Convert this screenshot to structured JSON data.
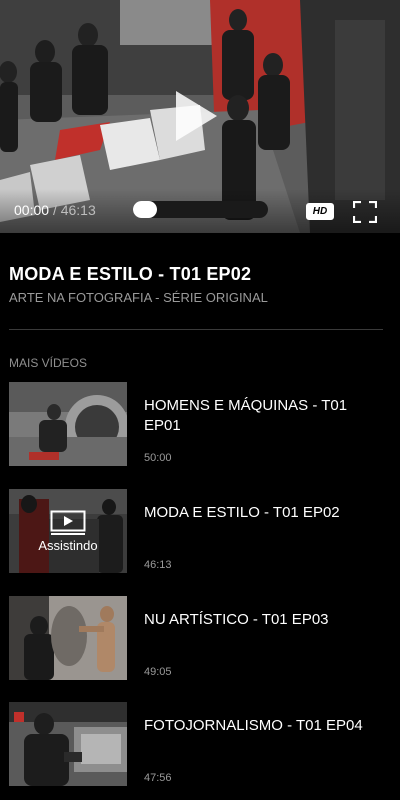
{
  "player": {
    "current_time": "00:00",
    "separator": "/",
    "duration": "46:13",
    "progress_fraction": 0.0,
    "quality_badge": "HD",
    "play_icon": "play-icon",
    "fullscreen_icon": "fullscreen-icon"
  },
  "video": {
    "title": "MODA E ESTILO - T01 EP02",
    "subtitle": "ARTE NA FOTOGRAFIA - SÉRIE ORIGINAL"
  },
  "more": {
    "label": "MAIS VÍDEOS",
    "items": [
      {
        "title": "HOMENS E MÁQUINAS - T01 EP01",
        "duration": "50:00",
        "watching": false
      },
      {
        "title": "MODA E ESTILO - T01 EP02",
        "duration": "46:13",
        "watching": true,
        "watching_label": "Assistindo"
      },
      {
        "title": "NU ARTÍSTICO - T01 EP03",
        "duration": "49:05",
        "watching": false
      },
      {
        "title": "FOTOJORNALISMO - T01 EP04",
        "duration": "47:56",
        "watching": false
      }
    ]
  },
  "colors": {
    "background": "#000000",
    "accent_red": "#c0302b",
    "muted_text": "#9a9a9a"
  }
}
